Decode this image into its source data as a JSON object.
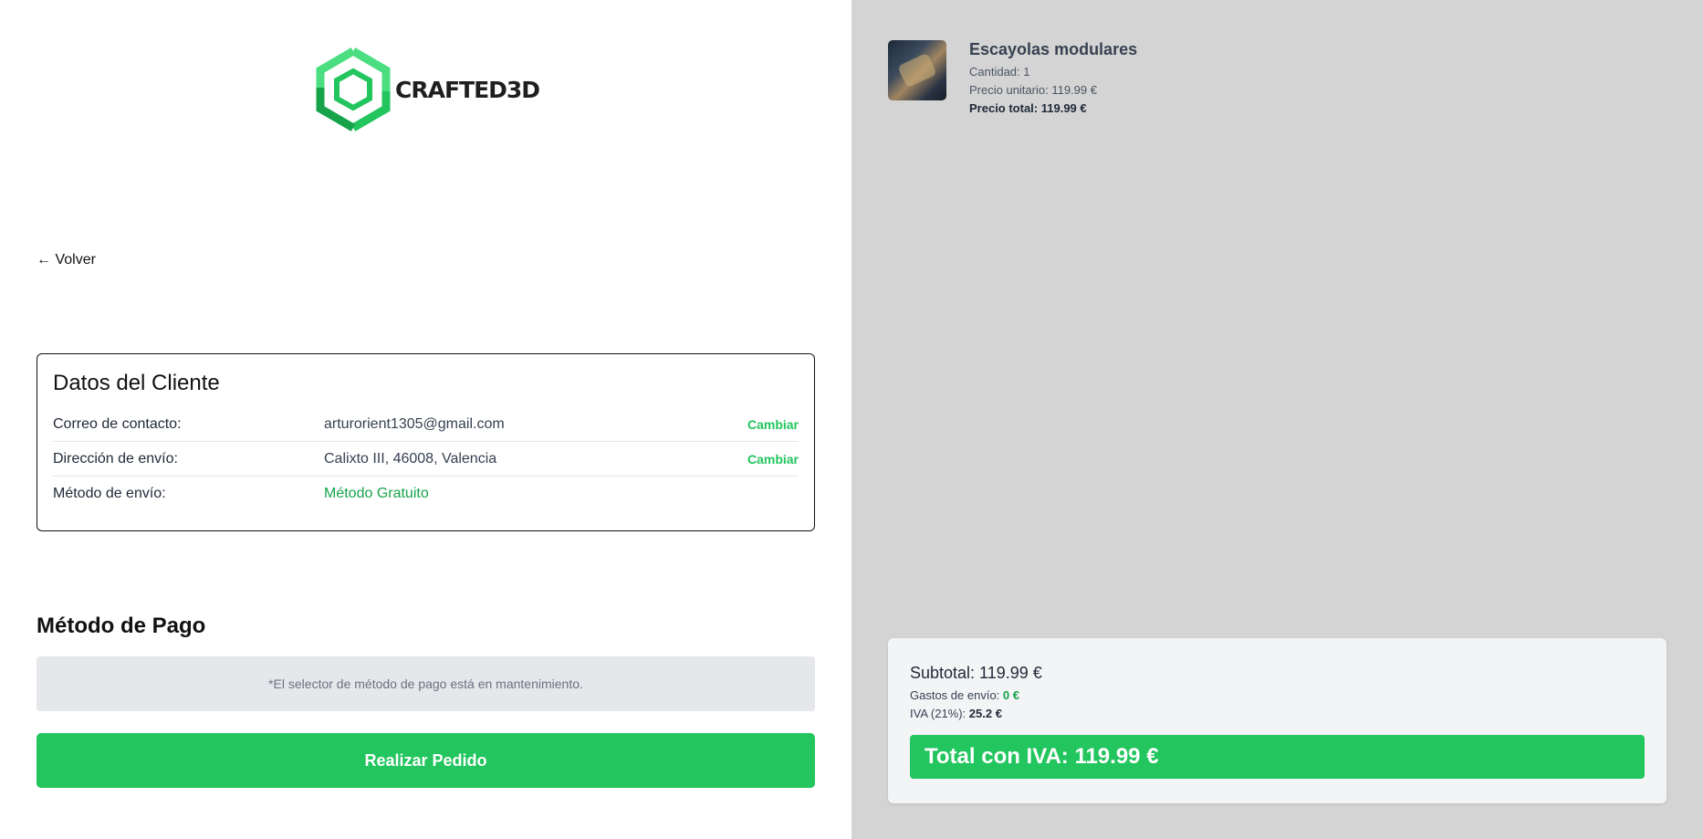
{
  "brand": {
    "logo_text": "CRAFTED3D",
    "logo_icon": "hexagon-logo-icon",
    "accent": "#22c55e"
  },
  "nav": {
    "back_label": "← Volver"
  },
  "client": {
    "title": "Datos del Cliente",
    "rows": [
      {
        "label": "Correo de contacto:",
        "value": "arturorient1305@gmail.com",
        "action": "Cambiar"
      },
      {
        "label": "Dirección de envío:",
        "value": "Calixto III, 46008, Valencia",
        "action": "Cambiar"
      },
      {
        "label": "Método de envío:",
        "value": "Método Gratuito"
      }
    ]
  },
  "payment": {
    "title": "Método de Pago",
    "notice": "*El selector de método de pago está en mantenimiento.",
    "submit_label": "Realizar Pedido"
  },
  "product": {
    "name": "Escayolas modulares",
    "quantity": "Cantidad: 1",
    "unit_price": "Precio unitario: 119.99 €",
    "total_price": "Precio total: 119.99 €"
  },
  "summary": {
    "subtotal": "Subtotal: 119.99 €",
    "shipping_label": "Gastos de envío: ",
    "shipping_value": "0 €",
    "tax_label": "IVA (21%): ",
    "tax_value": "25.2 €",
    "total": "Total con IVA: 119.99 €"
  }
}
